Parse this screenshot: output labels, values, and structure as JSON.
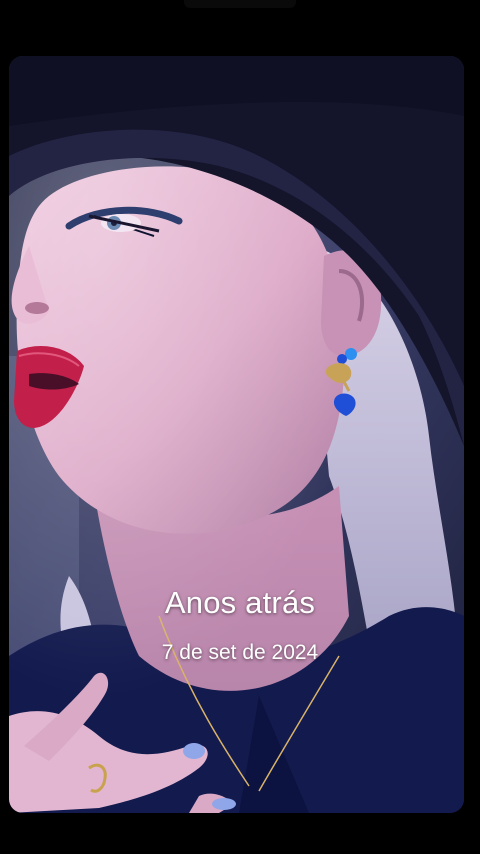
{
  "memory": {
    "title": "Anos atrás",
    "date": "7 de set de 2024"
  },
  "photo": {
    "icon": "portrait-photo"
  },
  "colors": {
    "background": "#000000",
    "text": "#ffffff",
    "hat": "#14142a",
    "skin": "#e3b2cf",
    "lips": "#c21f4a",
    "earring_stone": "#1f4fd6"
  }
}
